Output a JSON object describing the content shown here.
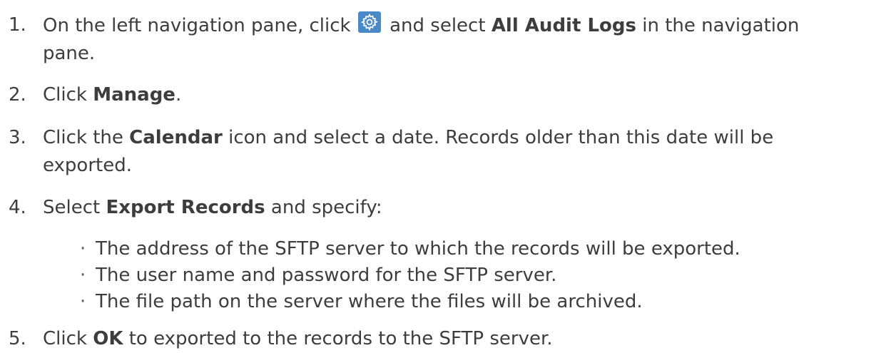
{
  "steps": [
    {
      "num": "1.",
      "t1": "On the left navigation pane, click",
      "t2": " and select ",
      "b1": "All Audit Logs",
      "t3": " in the navigation",
      "t4": "pane."
    },
    {
      "num": "2.",
      "t1": "Click ",
      "b1": "Manage",
      "t2": "."
    },
    {
      "num": "3.",
      "t1": "Click the ",
      "b1": "Calendar",
      "t2": " icon and select a date. Records older than this date will be",
      "t3": "exported."
    },
    {
      "num": "4.",
      "t1": "Select ",
      "b1": "Export Records",
      "t2": " and specify:"
    },
    {
      "num": "5.",
      "t1": "Click ",
      "b1": "OK",
      "t2": " to exported to the records to the SFTP server."
    }
  ],
  "bullets": [
    "The address of the SFTP server to which the records will be exported.",
    "The user name and password for the SFTP server.",
    "The file path on the server where the files will be archived."
  ],
  "bullet_glyph": "·",
  "icons": {
    "settings": "gear-icon"
  }
}
